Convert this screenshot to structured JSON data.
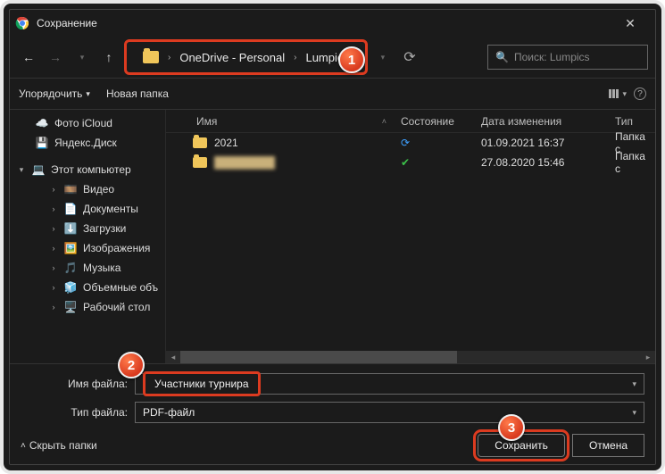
{
  "title": "Сохранение",
  "breadcrumb": {
    "p1": "OneDrive - Personal",
    "p2": "Lumpics"
  },
  "search": {
    "placeholder": "Поиск: Lumpics"
  },
  "toolbar": {
    "organize": "Упорядочить",
    "newfolder": "Новая папка"
  },
  "columns": {
    "name": "Имя",
    "state": "Состояние",
    "date": "Дата изменения",
    "type": "Тип"
  },
  "tree": {
    "icloud": "Фото iCloud",
    "yadisk": "Яндекс.Диск",
    "thispc": "Этот компьютер",
    "videos": "Видео",
    "docs": "Документы",
    "downloads": "Загрузки",
    "pictures": "Изображения",
    "music": "Музыка",
    "objects3d": "Объемные объ",
    "desktop": "Рабочий стол"
  },
  "rows": [
    {
      "name": "2021",
      "state": "sync",
      "date": "01.09.2021 16:37",
      "type": "Папка с"
    },
    {
      "name": "████████",
      "state": "ok",
      "date": "27.08.2020 15:46",
      "type": "Папка с"
    }
  ],
  "filename": {
    "label": "Имя файла:",
    "value": "Участники турнира"
  },
  "filetype": {
    "label": "Тип файла:",
    "value": "PDF-файл"
  },
  "hidefolders": "Скрыть папки",
  "buttons": {
    "save": "Сохранить",
    "cancel": "Отмена"
  },
  "markers": {
    "m1": "1",
    "m2": "2",
    "m3": "3"
  }
}
